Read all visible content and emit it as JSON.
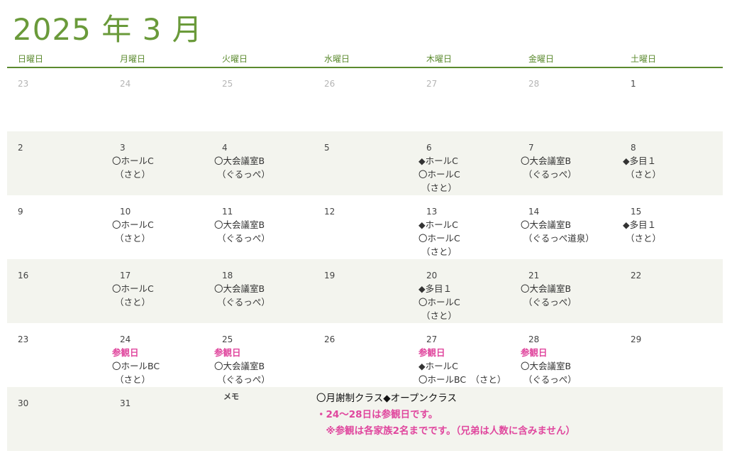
{
  "title": "2025 年 3 月",
  "weekdays": [
    "日曜日",
    "月曜日",
    "火曜日",
    "水曜日",
    "木曜日",
    "金曜日",
    "土曜日"
  ],
  "weeks": [
    [
      {
        "day": "23",
        "other": true,
        "events": []
      },
      {
        "day": "24",
        "other": true,
        "events": []
      },
      {
        "day": "25",
        "other": true,
        "events": []
      },
      {
        "day": "26",
        "other": true,
        "events": []
      },
      {
        "day": "27",
        "other": true,
        "events": []
      },
      {
        "day": "28",
        "other": true,
        "events": []
      },
      {
        "day": "1",
        "events": []
      }
    ],
    [
      {
        "day": "2",
        "events": []
      },
      {
        "day": "3",
        "events": [
          {
            "text": "〇ホールC"
          },
          {
            "text": "（さと）"
          }
        ]
      },
      {
        "day": "4",
        "events": [
          {
            "text": "〇大会議室B"
          },
          {
            "text": "（ぐるっぺ）"
          }
        ]
      },
      {
        "day": "5",
        "events": []
      },
      {
        "day": "6",
        "events": [
          {
            "text": "◆ホールC"
          },
          {
            "text": "〇ホールC"
          },
          {
            "text": "（さと）"
          }
        ]
      },
      {
        "day": "7",
        "events": [
          {
            "text": "〇大会議室B"
          },
          {
            "text": "（ぐるっぺ）"
          }
        ]
      },
      {
        "day": "8",
        "events": [
          {
            "text": "◆多目１"
          },
          {
            "text": "（さと）"
          }
        ]
      }
    ],
    [
      {
        "day": "9",
        "events": []
      },
      {
        "day": "10",
        "events": [
          {
            "text": "〇ホールC"
          },
          {
            "text": "（さと）"
          }
        ]
      },
      {
        "day": "11",
        "events": [
          {
            "text": "〇大会議室B"
          },
          {
            "text": "（ぐるっぺ）"
          }
        ]
      },
      {
        "day": "12",
        "events": []
      },
      {
        "day": "13",
        "events": [
          {
            "text": "◆ホールC"
          },
          {
            "text": "〇ホールC"
          },
          {
            "text": "（さと）"
          }
        ]
      },
      {
        "day": "14",
        "events": [
          {
            "text": "〇大会議室B"
          },
          {
            "text": "（ぐるっぺ道泉）"
          }
        ]
      },
      {
        "day": "15",
        "events": [
          {
            "text": "◆多目１"
          },
          {
            "text": "（さと）"
          }
        ]
      }
    ],
    [
      {
        "day": "16",
        "events": []
      },
      {
        "day": "17",
        "events": [
          {
            "text": "〇ホールC"
          },
          {
            "text": "（さと）"
          }
        ]
      },
      {
        "day": "18",
        "events": [
          {
            "text": "〇大会議室B"
          },
          {
            "text": "（ぐるっぺ）"
          }
        ]
      },
      {
        "day": "19",
        "events": []
      },
      {
        "day": "20",
        "events": [
          {
            "text": "◆多目１"
          },
          {
            "text": "〇ホールC"
          },
          {
            "text": "（さと）"
          }
        ]
      },
      {
        "day": "21",
        "events": [
          {
            "text": "〇大会議室B"
          },
          {
            "text": "（ぐるっぺ）"
          }
        ]
      },
      {
        "day": "22",
        "events": []
      }
    ],
    [
      {
        "day": "23",
        "events": []
      },
      {
        "day": "24",
        "events": [
          {
            "text": "参観日",
            "pink": true
          },
          {
            "text": "〇ホールBC"
          },
          {
            "text": "（さと）"
          }
        ]
      },
      {
        "day": "25",
        "events": [
          {
            "text": "参観日",
            "pink": true
          },
          {
            "text": "〇大会議室B"
          },
          {
            "text": "（ぐるっぺ）"
          }
        ]
      },
      {
        "day": "26",
        "events": []
      },
      {
        "day": "27",
        "events": [
          {
            "text": "参観日",
            "pink": true
          },
          {
            "text": "◆ホールC"
          },
          {
            "text": "〇ホールBC　（さと）"
          }
        ]
      },
      {
        "day": "28",
        "events": [
          {
            "text": "参観日",
            "pink": true
          },
          {
            "text": "〇大会議室B"
          },
          {
            "text": "（ぐるっぺ）"
          }
        ]
      },
      {
        "day": "29",
        "events": []
      }
    ],
    [
      {
        "day": "30",
        "events": []
      },
      {
        "day": "31",
        "events": []
      }
    ]
  ],
  "memo": {
    "label": "メモ",
    "lines": [
      {
        "text": "〇月謝制クラス◆オープンクラス",
        "style": "black"
      },
      {
        "text": "・24～28日は参観日です。",
        "style": "pink"
      },
      {
        "text": "　※参観は各家族2名までです。（兄弟は人数に含みません）",
        "style": "pink"
      }
    ]
  },
  "colors": {
    "accent": "#6a9a3a",
    "pink": "#e0479e",
    "shade": "#f3f4ee"
  }
}
